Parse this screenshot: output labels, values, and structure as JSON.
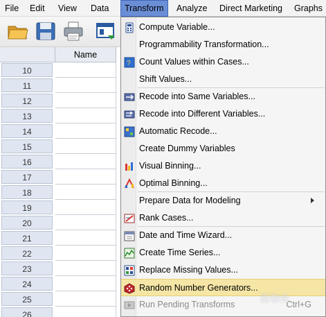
{
  "menubar": {
    "items": [
      {
        "label": "File"
      },
      {
        "label": "Edit"
      },
      {
        "label": "View"
      },
      {
        "label": "Data"
      },
      {
        "label": "Transform"
      },
      {
        "label": "Analyze"
      },
      {
        "label": "Direct Marketing"
      },
      {
        "label": "Graphs"
      }
    ],
    "active": "Transform"
  },
  "toolbar": {
    "buttons": [
      {
        "icon": "open-folder-icon"
      },
      {
        "icon": "save-icon"
      },
      {
        "icon": "print-icon"
      },
      {
        "icon": "dialog-recall-icon"
      }
    ]
  },
  "grid": {
    "column_header": "Name",
    "rows": [
      "10",
      "11",
      "12",
      "13",
      "14",
      "15",
      "16",
      "17",
      "18",
      "19",
      "20",
      "21",
      "22",
      "23",
      "24",
      "25",
      "26"
    ]
  },
  "transform_menu": {
    "items": [
      {
        "label": "Compute Variable...",
        "icon": "calculator-icon"
      },
      {
        "label": "Programmability Transformation...",
        "icon": ""
      },
      {
        "label": "Count Values within Cases...",
        "icon": "count-icon"
      },
      {
        "label": "Shift Values...",
        "icon": ""
      },
      {
        "label": "Recode into Same Variables...",
        "icon": "recode-same-icon"
      },
      {
        "label": "Recode into Different Variables...",
        "icon": "recode-different-icon"
      },
      {
        "label": "Automatic Recode...",
        "icon": "auto-recode-icon"
      },
      {
        "label": "Create Dummy Variables",
        "icon": ""
      },
      {
        "label": "Visual Binning...",
        "icon": "visual-binning-icon"
      },
      {
        "label": "Optimal Binning...",
        "icon": "optimal-binning-icon"
      },
      {
        "label": "Prepare Data for Modeling",
        "icon": "",
        "submenu": true
      },
      {
        "label": "Rank Cases...",
        "icon": "rank-icon"
      },
      {
        "label": "Date and Time Wizard...",
        "icon": "calendar-icon"
      },
      {
        "label": "Create Time Series...",
        "icon": "time-series-icon"
      },
      {
        "label": "Replace Missing Values...",
        "icon": "replace-missing-icon"
      },
      {
        "label": "Random Number Generators...",
        "icon": "dice-icon",
        "highlighted": true
      },
      {
        "label": "Run Pending Transforms",
        "icon": "run-pending-icon",
        "disabled": true,
        "shortcut": "Ctrl+G"
      }
    ]
  },
  "watermark": "医咖会",
  "colors": {
    "menubar_active": "#6b8fd6",
    "menu_highlight": "#f5e6a6",
    "row_header": "#dfe6f1"
  }
}
